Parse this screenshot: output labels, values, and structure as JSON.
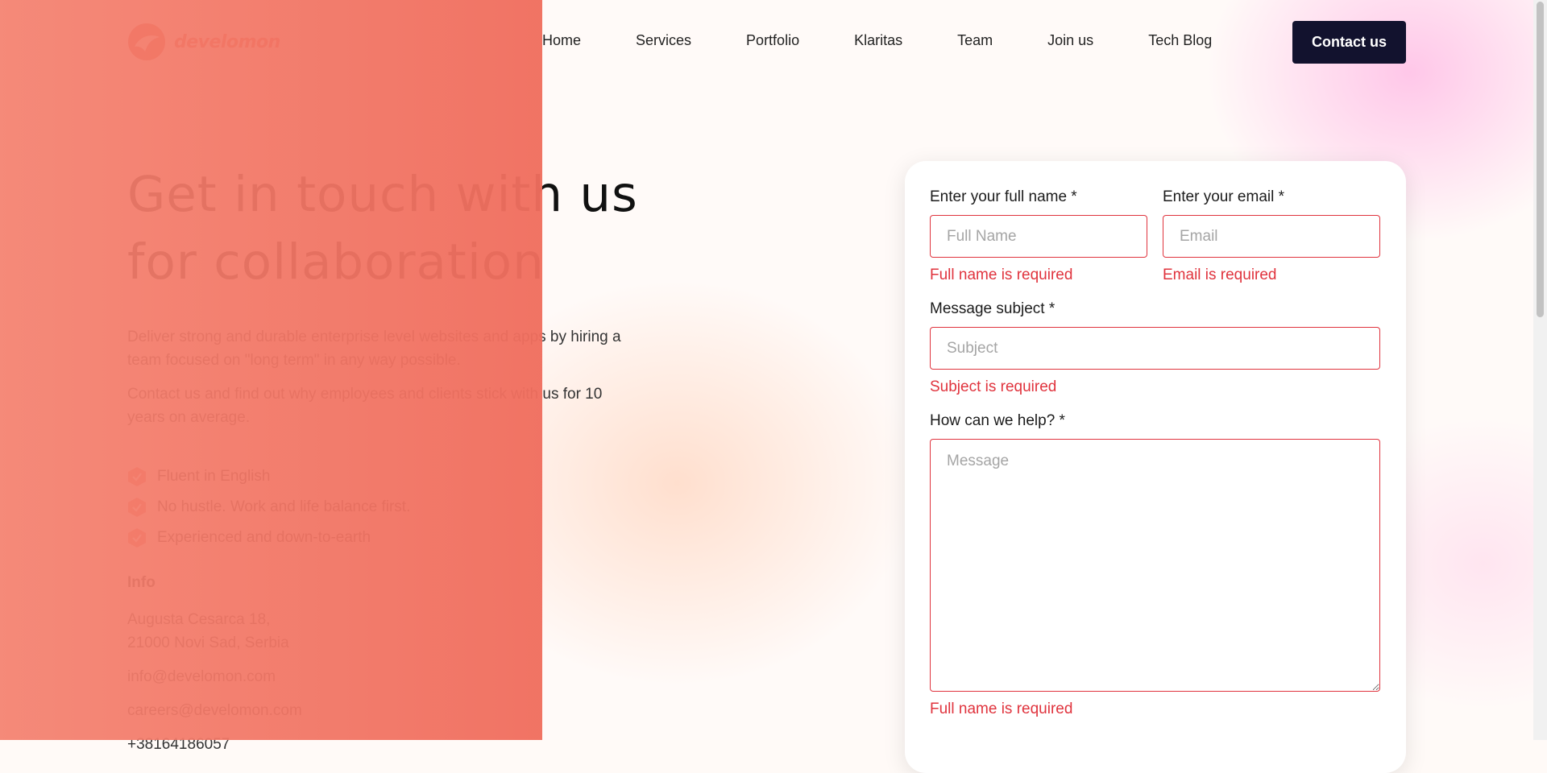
{
  "brand": {
    "name": "develomon",
    "accent": "#e9503f"
  },
  "nav": {
    "items": [
      "Home",
      "Services",
      "Portfolio",
      "Klaritas",
      "Team",
      "Join us",
      "Tech Blog"
    ],
    "cta": "Contact us"
  },
  "hero": {
    "title_line1": "Get in touch with us",
    "title_line2": "for collaboration",
    "paragraph1": "Deliver strong and durable enterprise level websites and apps by hiring a team focused on \"long term\" in any way possible.",
    "paragraph2": "Contact us and find out why employees and clients stick with us for 10 years on average.",
    "features": [
      "Fluent in English",
      "No hustle. Work and life balance first.",
      "Experienced and down-to-earth"
    ]
  },
  "info": {
    "title": "Info",
    "address_line1": "Augusta Cesarca 18,",
    "address_line2": "21000 Novi Sad, Serbia",
    "email_info": "info@develomon.com",
    "email_careers": "careers@develomon.com",
    "phone": "+38164186057"
  },
  "form": {
    "name_label": "Enter your full name *",
    "name_placeholder": "Full Name",
    "name_error": "Full name is required",
    "email_label": "Enter your email *",
    "email_placeholder": "Email",
    "email_error": "Email is required",
    "subject_label": "Message subject *",
    "subject_placeholder": "Subject",
    "subject_error": "Subject is required",
    "message_label": "How can we help? *",
    "message_placeholder": "Message",
    "message_error": "Full name is required"
  },
  "colors": {
    "overlay": "#f27b68",
    "error": "#e0333d",
    "cta_bg": "#12122e"
  }
}
